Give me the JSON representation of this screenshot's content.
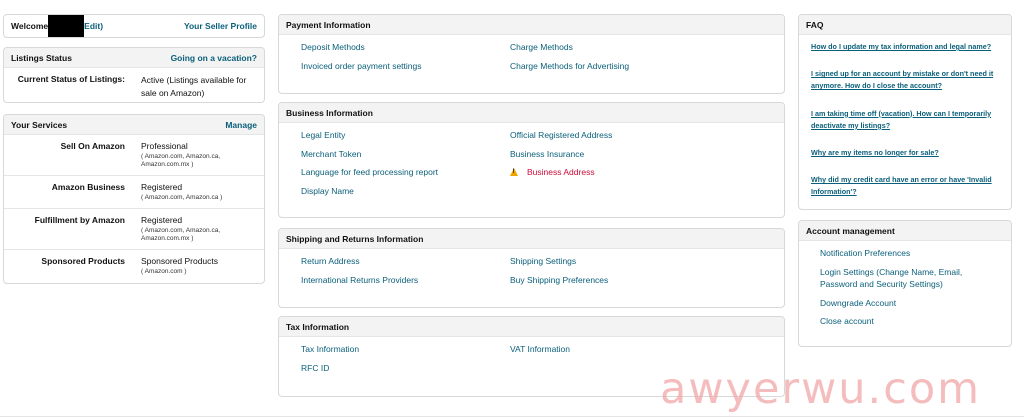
{
  "welcome": {
    "prefix": "Welcome",
    "edit": "Edit)",
    "seller_profile": "Your Seller Profile"
  },
  "listing_status": {
    "title": "Listings Status",
    "vacation_link": "Going on a vacation?",
    "label": "Current Status of Listings:",
    "value": "Active (Listings available for sale on Amazon)"
  },
  "services": {
    "title": "Your Services",
    "manage": "Manage",
    "rows": [
      {
        "label": "Sell On Amazon",
        "value": "Professional",
        "sub": "( Amazon.com, Amazon.ca, Amazon.com.mx )"
      },
      {
        "label": "Amazon Business",
        "value": "Registered",
        "sub": "( Amazon.com, Amazon.ca )"
      },
      {
        "label": "Fulfillment by Amazon",
        "value": "Registered",
        "sub": "( Amazon.com, Amazon.ca, Amazon.com.mx )"
      },
      {
        "label": "Sponsored Products",
        "value": "Sponsored Products",
        "sub": "( Amazon.com )"
      }
    ]
  },
  "payment": {
    "title": "Payment Information",
    "links": [
      "Deposit Methods",
      "Charge Methods",
      "Invoiced order payment settings",
      "Charge Methods for Advertising"
    ]
  },
  "business": {
    "title": "Business Information",
    "links": [
      "Legal Entity",
      "Official Registered Address",
      "Merchant Token",
      "Business Insurance",
      "Language for feed processing report",
      "Business Address",
      "Display Name"
    ]
  },
  "shipping": {
    "title": "Shipping and Returns Information",
    "links": [
      "Return Address",
      "Shipping Settings",
      "International Returns Providers",
      "Buy Shipping Preferences"
    ]
  },
  "tax": {
    "title": "Tax Information",
    "links": [
      "Tax Information",
      "VAT Information",
      "RFC ID"
    ]
  },
  "faq": {
    "title": "FAQ",
    "items": [
      "How do I update my tax information and legal name?",
      "I signed up for an account by mistake or don't need it anymore. How do I close the account?",
      "I am taking time off (vacation). How can I temporarily deactivate my listings?",
      "Why are my items no longer for sale?",
      "Why did my credit card have an error or have 'Invalid Information'?"
    ]
  },
  "account": {
    "title": "Account management",
    "items": [
      "Notification Preferences",
      "Login Settings (Change Name, Email, Password and Security Settings)",
      "Downgrade Account",
      "Close account"
    ]
  },
  "colors": {
    "link": "#0a5f7a",
    "warning": "#cc0c39",
    "warning_icon": "#f0a500"
  },
  "watermark": "awyerwu.com"
}
